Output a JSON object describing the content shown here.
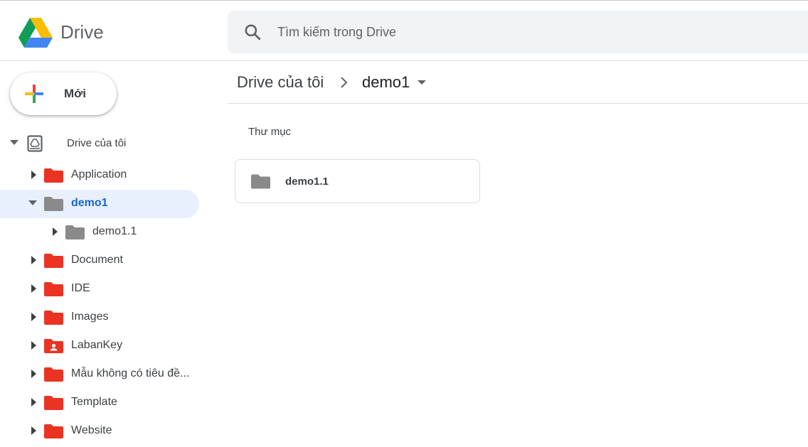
{
  "app": {
    "brand": "Drive",
    "colors": {
      "folder_red": "#ea3323",
      "folder_grey": "#8a8a8a",
      "selected_bg": "#e8f0fe",
      "selected_text": "#1967d2"
    }
  },
  "search": {
    "placeholder": "Tìm kiếm trong Drive"
  },
  "new_button": {
    "label": "Mới",
    "icon": "plus-multicolor-icon"
  },
  "sidebar": {
    "root": {
      "label": "Drive của tôi",
      "icon": "my-drive-icon",
      "expanded": true
    },
    "items": [
      {
        "label": "Application",
        "icon": "folder-icon",
        "color": "red",
        "expanded": false,
        "selected": false
      },
      {
        "label": "demo1",
        "icon": "folder-icon",
        "color": "grey",
        "expanded": true,
        "selected": true
      },
      {
        "label": "demo1.1",
        "icon": "folder-icon",
        "color": "grey",
        "expanded": false,
        "selected": false
      },
      {
        "label": "Document",
        "icon": "folder-icon",
        "color": "red",
        "expanded": false,
        "selected": false
      },
      {
        "label": "IDE",
        "icon": "folder-icon",
        "color": "red",
        "expanded": false,
        "selected": false
      },
      {
        "label": "Images",
        "icon": "folder-icon",
        "color": "red",
        "expanded": false,
        "selected": false
      },
      {
        "label": "LabanKey",
        "icon": "shared-folder-icon",
        "color": "red",
        "expanded": false,
        "selected": false
      },
      {
        "label": "Mẫu không có tiêu đề...",
        "icon": "folder-icon",
        "color": "red",
        "expanded": false,
        "selected": false
      },
      {
        "label": "Template",
        "icon": "folder-icon",
        "color": "red",
        "expanded": false,
        "selected": false
      },
      {
        "label": "Website",
        "icon": "folder-icon",
        "color": "red",
        "expanded": false,
        "selected": false
      }
    ]
  },
  "breadcrumb": {
    "root": "Drive của tôi",
    "current": "demo1"
  },
  "main": {
    "section_title": "Thư mục",
    "folders": [
      {
        "label": "demo1.1",
        "icon": "folder-icon"
      }
    ]
  }
}
